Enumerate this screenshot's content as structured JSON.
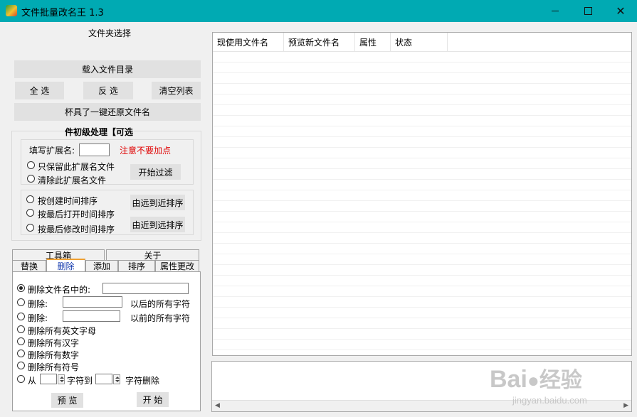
{
  "window": {
    "title": "文件批量改名王   1.3",
    "min_icon": "minimize-icon",
    "max_icon": "maximize-icon",
    "close_icon": "close-icon"
  },
  "folder": {
    "group_label": "文件夹选择",
    "load_button": "载入文件目录",
    "select_all": "全 选",
    "invert": "反 选",
    "clear_list": "清空列表",
    "restore_button": "杯具了一键还原文件名"
  },
  "prefilter": {
    "group_label": "件初级处理【可选",
    "ext_label": "填写扩展名:",
    "ext_value": "",
    "ext_warning": "注意不要加点",
    "keep_only": "只保留此扩展名文件",
    "remove_ext": "清除此扩展名文件",
    "start_filter": "开始过滤",
    "sort_created": "按创建时间排序",
    "sort_opened": "按最后打开时间排序",
    "sort_modified": "按最后修改时间排序",
    "far_to_near": "由远到近排序",
    "near_to_far": "由近到远排序"
  },
  "tabs": {
    "top_row": [
      "工具箱",
      "关于"
    ],
    "bottom_row": [
      "替换",
      "删除",
      "添加",
      "排序",
      "属性更改"
    ],
    "active": "删除"
  },
  "delete_panel": {
    "opt_contains": "删除文件名中的:",
    "opt_after": "删除:",
    "after_suffix": "以后的所有字符",
    "opt_before": "删除:",
    "before_suffix": "以前的所有字符",
    "opt_english": "删除所有英文字母",
    "opt_chinese": "删除所有汉字",
    "opt_digits": "删除所有数字",
    "opt_symbols": "删除所有符号",
    "opt_range_from": "从",
    "range_to": "字符到",
    "range_suffix": "字符删除",
    "preview_button": "预 览",
    "start_button": "开 始",
    "selected": "opt_contains"
  },
  "listview": {
    "columns": [
      "现使用文件名",
      "预览新文件名",
      "属性",
      "状态"
    ],
    "rows": []
  },
  "log": {
    "text": ""
  },
  "watermark": {
    "brand": "Bai",
    "brand_cn": "经验",
    "url": "jingyan.baidu.com"
  }
}
